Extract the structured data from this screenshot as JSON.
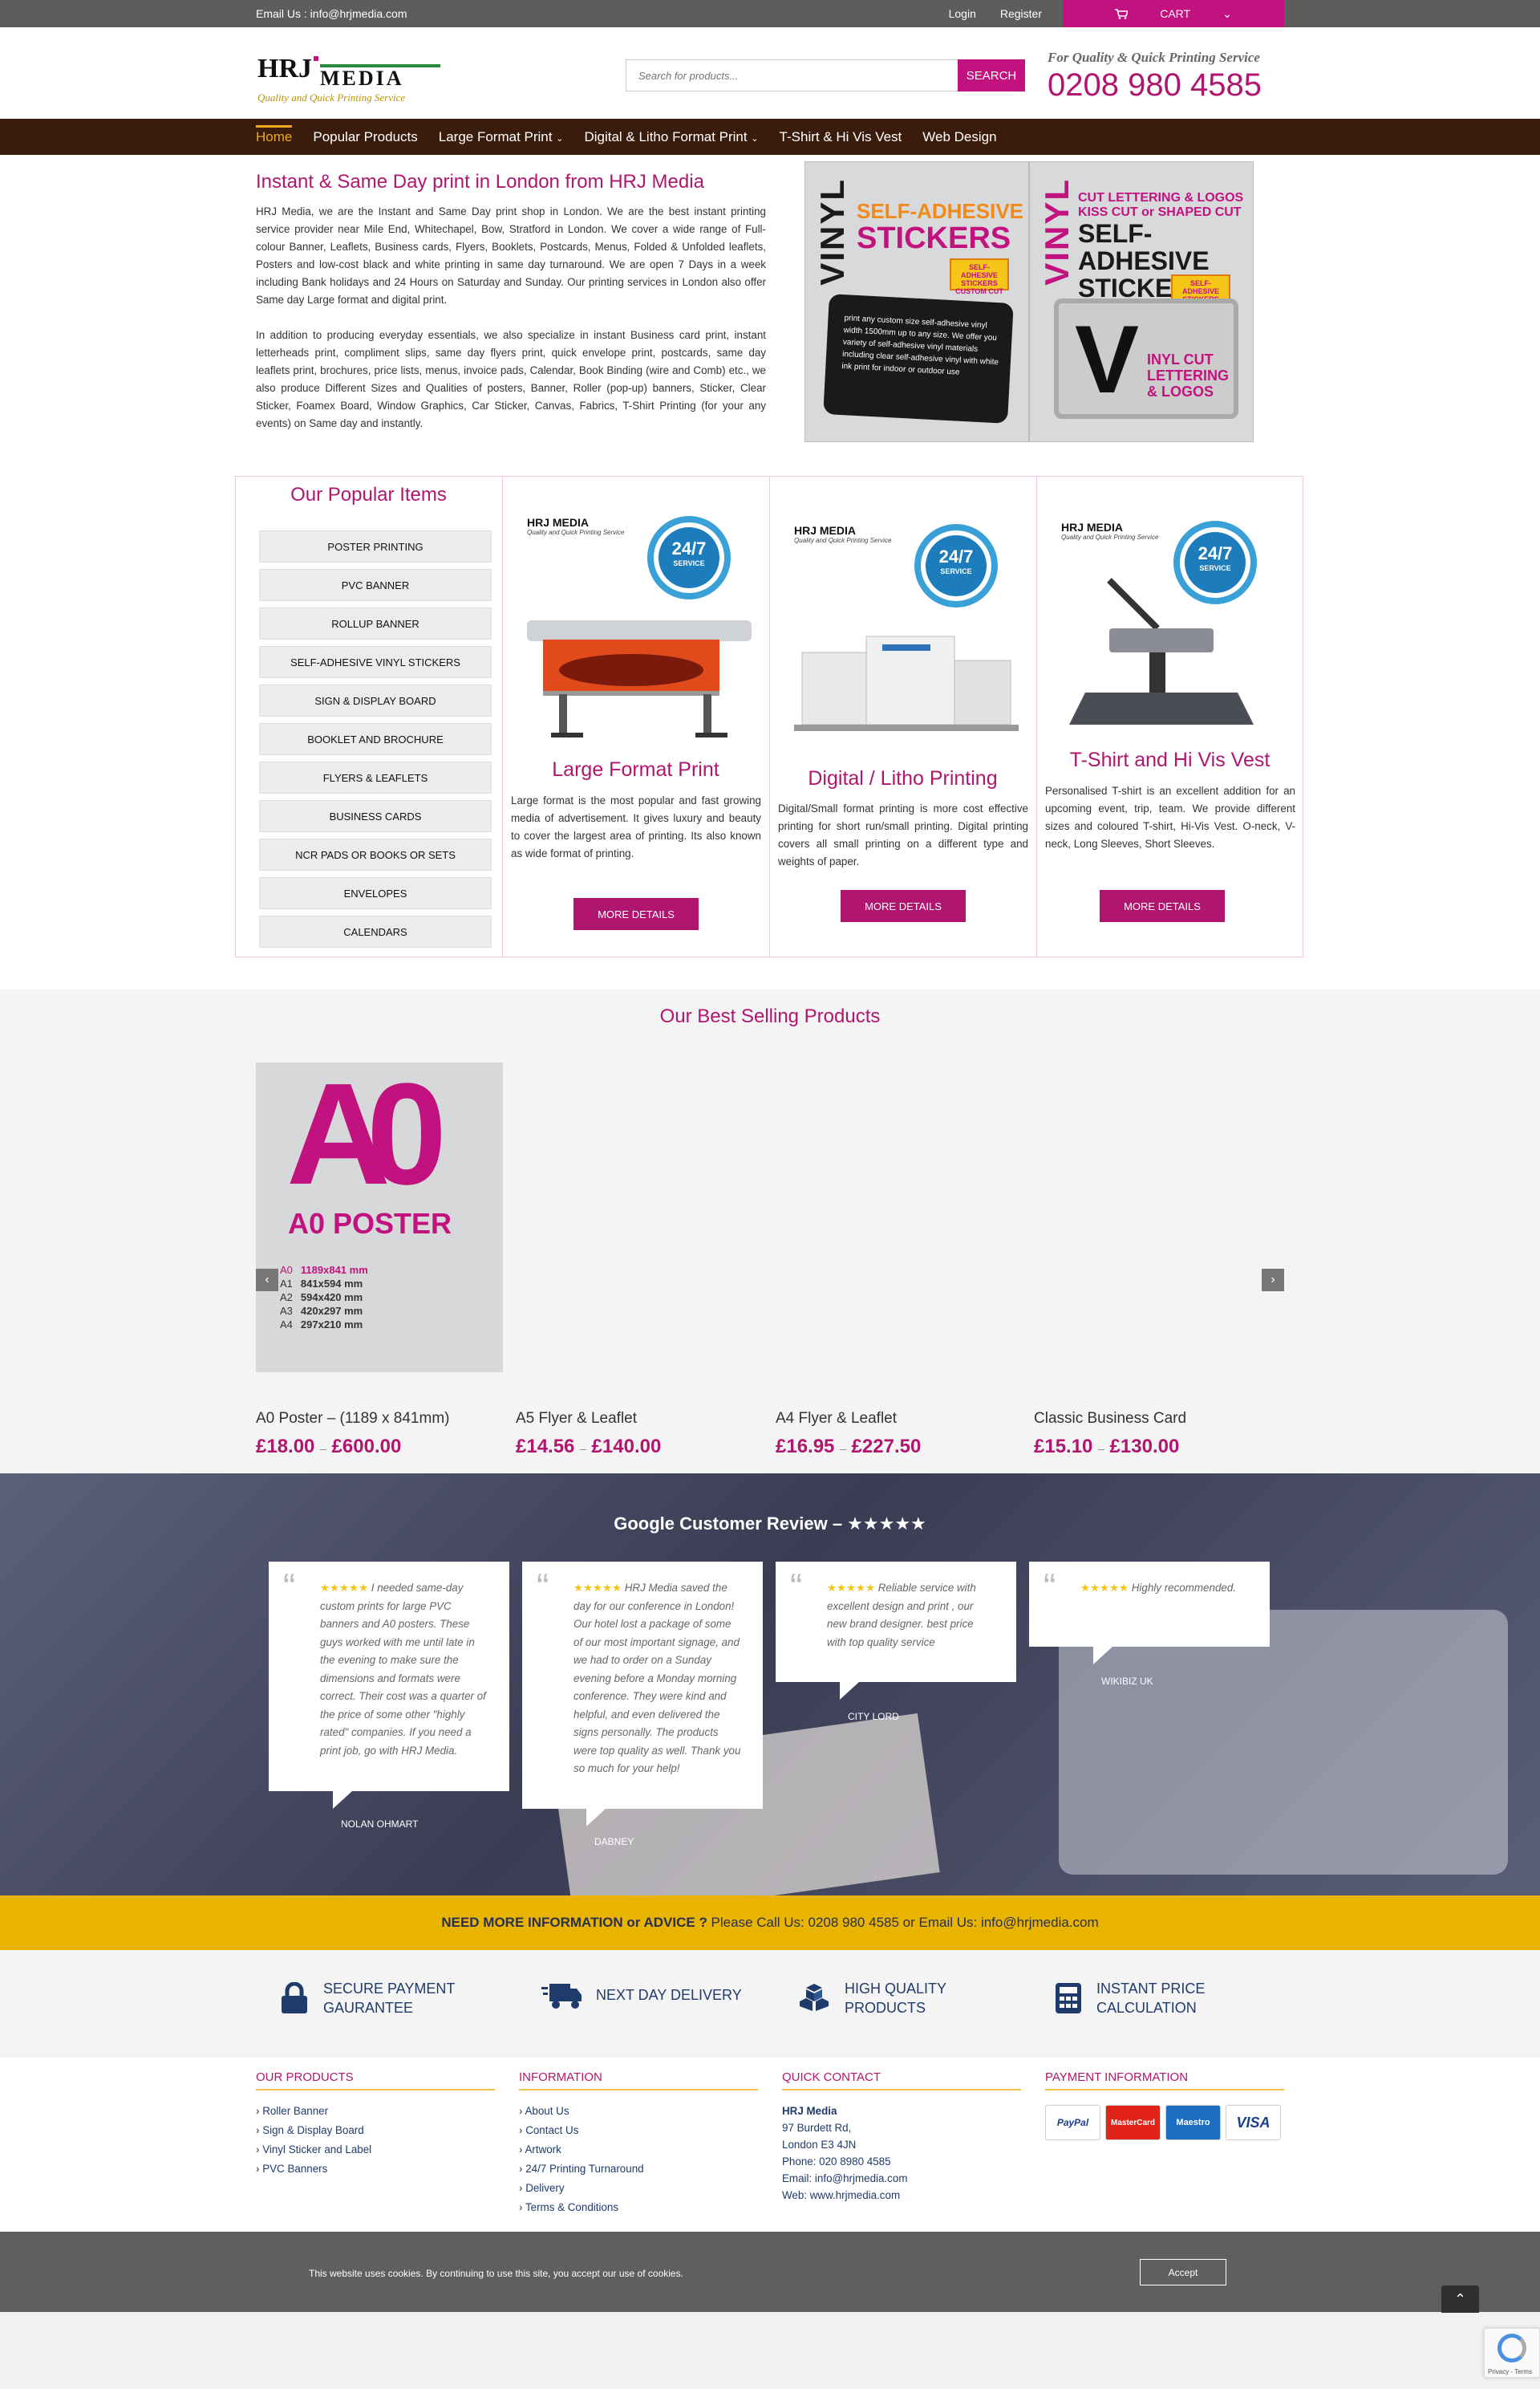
{
  "topbar": {
    "email": "Email Us : info@hrjmedia.com",
    "login": "Login",
    "register": "Register",
    "cart": "CART"
  },
  "header": {
    "logo_main": "HRJ MEDIA",
    "logo_tag": "Quality and Quick Printing Service",
    "search_placeholder": "Search for products...",
    "search_btn": "SEARCH",
    "tagline": "For Quality & Quick Printing Service",
    "phone": "0208 980 4585"
  },
  "nav": [
    "Home",
    "Popular Products",
    "Large Format Print",
    "Digital & Litho Format Print",
    "T-Shirt & Hi Vis Vest",
    "Web Design"
  ],
  "intro": {
    "title": "Instant & Same Day print in London from HRJ Media",
    "p1": "HRJ Media, we are the Instant and Same Day print shop in London. We are the best instant printing service provider near Mile End, Whitechapel, Bow, Stratford in London. We cover a wide range of Full-colour Banner, Leaflets, Business cards, Flyers, Booklets, Postcards, Menus, Folded & Unfolded leaflets, Posters and low-cost black and white printing in same day turnaround. We are open 7 Days in a week including Bank holidays and 24 Hours on Saturday and Sunday. Our printing services in London also offer Same day Large format and digital print.",
    "p2": "In addition to producing everyday essentials, we also specialize in instant Business card print, instant letterheads print, compliment slips, same day flyers print, quick envelope print, postcards, same day leaflets print, brochures, price lists, menus, invoice pads, Calendar, Book Binding (wire and Comb) etc., we also produce Different Sizes and Qualities of posters, Banner, Roller (pop-up) banners, Sticker, Clear Sticker, Foamex Board, Window Graphics, Car Sticker, Canvas, Fabrics, T-Shirt Printing (for your any events) on Same day and instantly."
  },
  "ad": {
    "left_vert": "VINYL",
    "left_l1": "SELF-ADHESIVE",
    "left_l2": "STICKERS",
    "left_badge": "SELF-ADHESIVE STICKERS CUSTOM CUT",
    "left_sticker": "print any custom size self-adhesive vinyl width 1500mm up to any size. We offer you variety of self-adhesive vinyl materials including clear self-adhesive vinyl with white ink print for indoor or outdoor use",
    "right_vert": "VINYL",
    "right_l1": "CUT LETTERING & LOGOS KISS CUT or SHAPED CUT",
    "right_l2": "SELF-ADHESIVE STICKERS",
    "right_badge": "SELF-ADHESIVE STICKERS CUSTOM CUT",
    "right_v": "V",
    "right_vt": "INYL CUT LETTERING & LOGOS"
  },
  "popular": {
    "title": "Our Popular Items",
    "items": [
      "POSTER PRINTING",
      "PVC BANNER",
      "ROLLUP BANNER",
      "SELF-ADHESIVE VINYL STICKERS",
      "SIGN & DISPLAY BOARD",
      "BOOKLET AND BROCHURE",
      "FLYERS & LEAFLETS",
      "BUSINESS CARDS",
      "NCR PADS OR BOOKS OR SETS",
      "ENVELOPES",
      "CALENDARS"
    ],
    "cards": [
      {
        "title": "Large Format Print",
        "text": "Large format is the most popular and fast growing media of advertisement. It gives luxury and beauty to cover the largest area of printing. Its also known as wide format of printing.",
        "btn": "MORE DETAILS"
      },
      {
        "title": "Digital / Litho Printing",
        "text": "Digital/Small format printing is more cost effective printing for short run/small printing. Digital printing covers all small printing on a different type and weights of paper.",
        "btn": "MORE DETAILS"
      },
      {
        "title": "T-Shirt and Hi Vis Vest",
        "text": "Personalised T-shirt is an excellent addition for an upcoming event, trip, team. We provide different sizes and coloured T-shirt, Hi-Vis Vest. O-neck, V-neck, Long Sleeves, Short Sleeves.",
        "btn": "MORE DETAILS"
      }
    ],
    "service_badge": {
      "num": "24/7",
      "label": "SERVICE"
    },
    "mini_logo": "HRJ MEDIA",
    "mini_tag": "Quality and Quick Printing Service"
  },
  "best": {
    "title": "Our Best Selling Products",
    "poster": {
      "big": "A0",
      "label": "A0 POSTER",
      "sizes": [
        [
          "A0",
          "1189x841 mm"
        ],
        [
          "A1",
          "841x594 mm"
        ],
        [
          "A2",
          "594x420 mm"
        ],
        [
          "A3",
          "420x297 mm"
        ],
        [
          "A4",
          "297x210 mm"
        ]
      ]
    },
    "products": [
      {
        "name": "A0 Poster – (1189 x 841mm)",
        "low": "£18.00",
        "high": "£600.00"
      },
      {
        "name": "A5 Flyer & Leaflet",
        "low": "£14.56",
        "high": "£140.00"
      },
      {
        "name": "A4 Flyer & Leaflet",
        "low": "£16.95",
        "high": "£227.50"
      },
      {
        "name": "Classic Business Card",
        "low": "£15.10",
        "high": "£130.00"
      }
    ],
    "dash": "–"
  },
  "reviews": {
    "title": "Google Customer Review – ★★★★★",
    "quote_mark": "“",
    "items": [
      {
        "stars": "★★★★★",
        "text": "I needed same-day custom prints for large PVC banners and A0 posters. These guys worked with me until late in the evening to make sure the dimensions and formats were correct. Their cost was a quarter of the price of some other \"highly rated\" companies. If you need a print job, go with HRJ Media.",
        "who": "NOLAN OHMART"
      },
      {
        "stars": "★★★★★",
        "text": "HRJ Media saved the day for our conference in London! Our hotel lost a package of some of our most important signage, and we had to order on a Sunday evening before a Monday morning conference. They were kind and helpful, and even delivered the signs personally. The products were top quality as well. Thank you so much for your help!",
        "who": "DABNEY"
      },
      {
        "stars": "★★★★★",
        "text": "Reliable service with excellent design and print , our new brand designer. best price with top quality service",
        "who": "CITY LORD"
      },
      {
        "stars": "★★★★★",
        "text": "Highly recommended.",
        "who": "WIKIBIZ UK"
      }
    ]
  },
  "advice": {
    "bold": "NEED MORE INFORMATION or ADVICE ?",
    "rest": " Please Call Us: 0208 980 4585 or Email Us: info@hrjmedia.com"
  },
  "features": [
    {
      "l1": "SECURE PAYMENT",
      "l2": "GAURANTEE",
      "icon": "lock-icon"
    },
    {
      "l1": "NEXT DAY DELIVERY",
      "l2": "",
      "icon": "truck-icon"
    },
    {
      "l1": "HIGH QUALITY",
      "l2": "PRODUCTS",
      "icon": "boxes-icon"
    },
    {
      "l1": "INSTANT PRICE",
      "l2": "CALCULATION",
      "icon": "calculator-icon"
    }
  ],
  "footer": {
    "products_title": "OUR PRODUCTS",
    "products": [
      "Roller Banner",
      "Sign & Display Board",
      "Vinyl Sticker and Label",
      "PVC Banners"
    ],
    "info_title": "INFORMATION",
    "info": [
      "About Us",
      "Contact Us",
      "Artwork",
      "24/7 Printing Turnaround",
      "Delivery",
      "Terms & Conditions"
    ],
    "contact_title": "QUICK CONTACT",
    "contact": [
      "HRJ Media",
      "97 Burdett Rd,",
      "London E3 4JN",
      "Phone: 020 8980 4585",
      "Email: info@hrjmedia.com",
      "Web: www.hrjmedia.com"
    ],
    "payment_title": "PAYMENT INFORMATION",
    "payments": [
      "PayPal",
      "MasterCard",
      "Maestro",
      "VISA"
    ]
  },
  "cookie": {
    "text": "This website uses cookies. By continuing to use this site, you accept our use of cookies.",
    "accept": "Accept"
  },
  "recaptcha": {
    "links": "Privacy - Terms"
  },
  "colors": {
    "brand": "#b0156f",
    "nav": "#3a1c0c",
    "accent": "#e8b400",
    "topbar": "#5d5d5d"
  }
}
